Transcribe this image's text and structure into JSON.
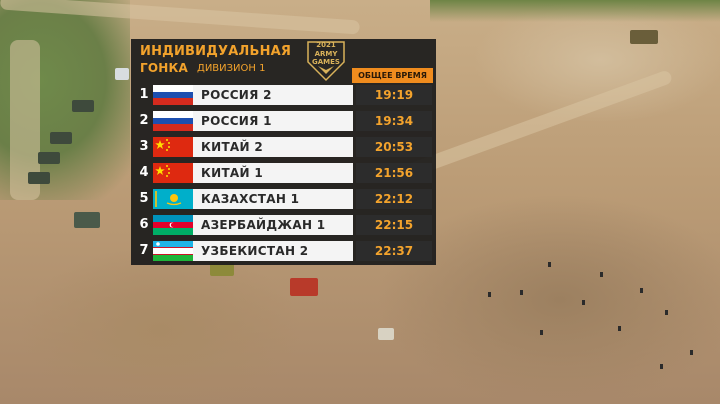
{
  "overlay": {
    "title_line1": "ИНДИВИДУАЛЬНАЯ",
    "title_line2": "ГОНКА",
    "division": "ДИВИЗИОН 1",
    "logo_year": "2021",
    "logo_line1": "ARMY",
    "logo_line2": "GAMES",
    "time_header": "ОБЩЕЕ ВРЕМЯ",
    "rows": [
      {
        "position": "1",
        "team": "РОССИЯ 2",
        "flag": "russia-flag",
        "time": "19:19"
      },
      {
        "position": "2",
        "team": "РОССИЯ 1",
        "flag": "russia-flag",
        "time": "19:34"
      },
      {
        "position": "3",
        "team": "КИТАЙ 2",
        "flag": "china-flag",
        "time": "20:53"
      },
      {
        "position": "4",
        "team": "КИТАЙ 1",
        "flag": "china-flag",
        "time": "21:56"
      },
      {
        "position": "5",
        "team": "КАЗАХСТАН 1",
        "flag": "kazakhstan-flag",
        "time": "22:12"
      },
      {
        "position": "6",
        "team": "АЗЕРБАЙДЖАН 1",
        "flag": "azerbaijan-flag",
        "time": "22:15"
      },
      {
        "position": "7",
        "team": "УЗБЕКИСТАН 2",
        "flag": "uzbekistan-flag",
        "time": "22:37"
      }
    ]
  },
  "colors": {
    "accent_orange": "#f08c1e",
    "title_gold": "#f3a32c",
    "panel_dark": "#1c1c1c"
  }
}
